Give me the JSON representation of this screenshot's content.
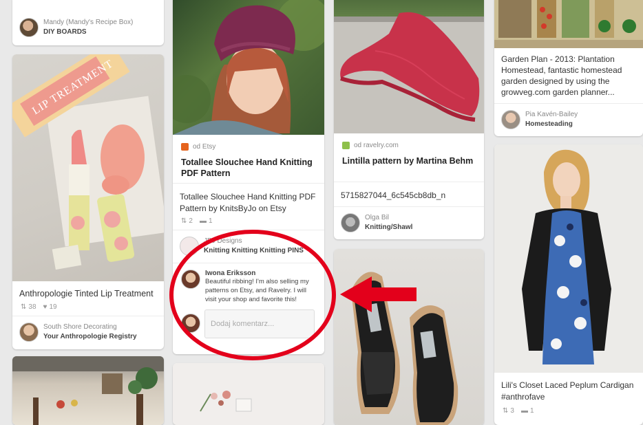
{
  "col1": {
    "top_card": {
      "user": "Mandy (Mandy's Recipe Box)",
      "board": "DIY BOARDS"
    },
    "lip_card": {
      "image_text": "LIP TREATMENT",
      "description": "Anthropologie Tinted Lip Treatment",
      "repins": "38",
      "likes": "19",
      "user": "South Shore Decorating",
      "board": "Your Anthropologie Registry"
    }
  },
  "col2": {
    "hat_card": {
      "source": "od Etsy",
      "title": "Totallee Slouchee Hand Knitting PDF Pattern",
      "description": "Totallee Slouchee Hand Knitting PDF Pattern by KnitsByJo on Etsy",
      "repins": "2",
      "comments": "1",
      "user": "JBJ Designs",
      "board": "Knitting Knitting Knitting PINS",
      "comment": {
        "author": "Iwona Eriksson",
        "text": "Beautiful ribbing! I'm also selling my patterns on Etsy, and Ravelry. I will visit your shop and favorite this!"
      },
      "comment_placeholder": "Dodaj komentarz..."
    }
  },
  "col3": {
    "shawl_card": {
      "source": "od ravelry.com",
      "title": "Lintilla pattern by Martina Behm",
      "description": "5715827044_6c545cb8db_n",
      "user": "Olga Bil",
      "board": "Knitting/Shawl"
    }
  },
  "col4": {
    "garden_card": {
      "description": "Garden Plan - 2013: Plantation Homestead, fantastic homestead garden designed by using the growveg.com garden planner...",
      "user": "Pia Kavén-Bailey",
      "board": "Homesteading"
    },
    "dress_card": {
      "description": "Lili's Closet Laced Peplum Cardigan #anthrofave",
      "repins": "3",
      "likes": "1"
    }
  },
  "colors": {
    "annotation": "#e3001b",
    "etsy": "#e5631d",
    "ravelry": "#8ec04a"
  },
  "icons": {
    "repin": "repin-icon",
    "like": "heart-icon",
    "comment": "comment-icon"
  }
}
